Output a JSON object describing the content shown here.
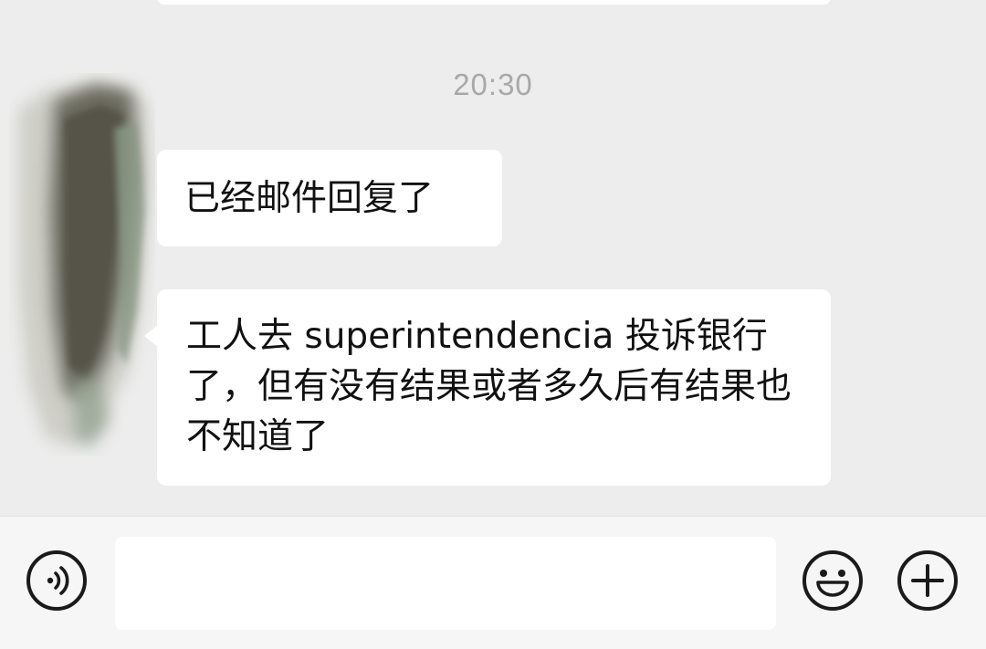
{
  "chat": {
    "timestamp": "20:30",
    "messages": [
      {
        "text": "已经邮件回复了"
      },
      {
        "text": "工人去 superintendencia 投诉银行了，但有没有结果或者多久后有结果也不知道了"
      }
    ]
  },
  "input_bar": {
    "message_value": "",
    "icons": {
      "voice": "voice-icon",
      "emoji": "emoji-icon",
      "more": "plus-icon"
    }
  }
}
